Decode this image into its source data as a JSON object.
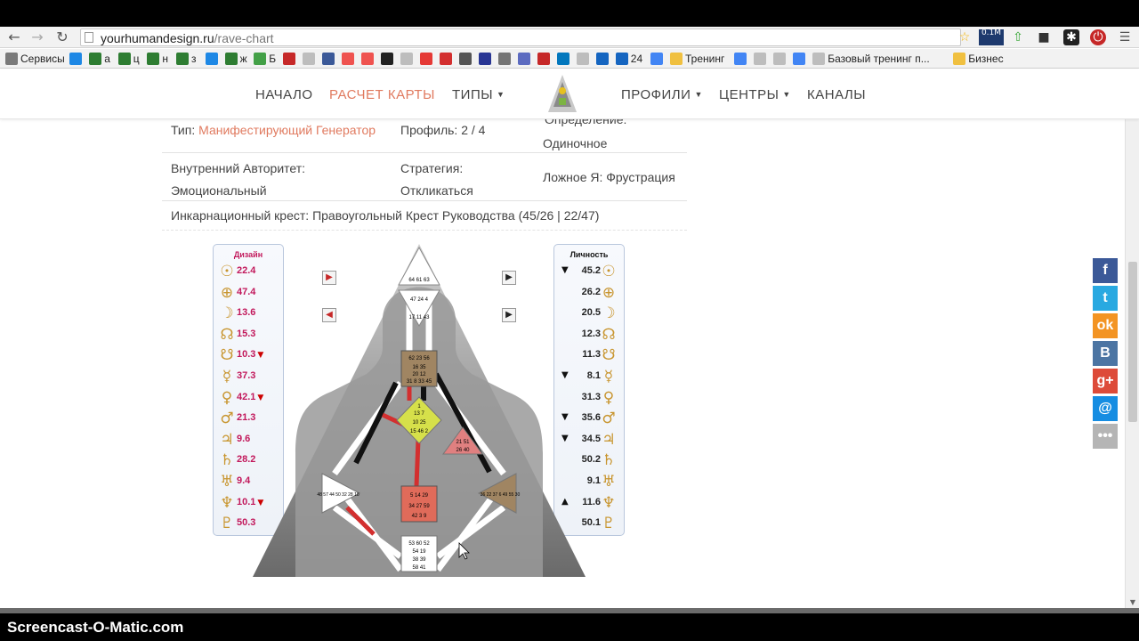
{
  "browser": {
    "url_host": "yourhumandesign.ru",
    "url_path": "/rave-chart",
    "extensions": [
      "star-icon",
      "rss-badge-icon",
      "arrow-up-icon",
      "puzzle-icon",
      "asterisk-icon",
      "stop-icon",
      "menu-icon"
    ],
    "rss_badge": "0.1M"
  },
  "bookmarks": [
    {
      "label": "Сервисы",
      "color": "#7a7a7a"
    },
    {
      "label": "",
      "color": "#1e88e5"
    },
    {
      "label": "а",
      "color": "#2e7d32"
    },
    {
      "label": "ц",
      "color": "#2e7d32"
    },
    {
      "label": "н",
      "color": "#2e7d32"
    },
    {
      "label": "з",
      "color": "#2e7d32"
    },
    {
      "label": "",
      "color": "#1e88e5"
    },
    {
      "label": "ж",
      "color": "#2e7d32"
    },
    {
      "label": "Б",
      "color": "#43a047"
    },
    {
      "label": "",
      "color": "#c62828"
    },
    {
      "label": "",
      "color": "#bdbdbd"
    },
    {
      "label": "",
      "color": "#3b5998"
    },
    {
      "label": "",
      "color": "#ef5350"
    },
    {
      "label": "",
      "color": "#ef5350"
    },
    {
      "label": "",
      "color": "#222222"
    },
    {
      "label": "",
      "color": "#bdbdbd"
    },
    {
      "label": "",
      "color": "#e53935"
    },
    {
      "label": "",
      "color": "#d32f2f"
    },
    {
      "label": "",
      "color": "#555555"
    },
    {
      "label": "",
      "color": "#283593"
    },
    {
      "label": "",
      "color": "#757575"
    },
    {
      "label": "",
      "color": "#5c6bc0"
    },
    {
      "label": "",
      "color": "#c62828"
    },
    {
      "label": "",
      "color": "#0277bd"
    },
    {
      "label": "",
      "color": "#bdbdbd"
    },
    {
      "label": "",
      "color": "#1565c0"
    },
    {
      "label": "24",
      "color": "#1565c0"
    },
    {
      "label": "",
      "color": "#4285f4"
    },
    {
      "label": "Тренинг",
      "color": "#f0c040"
    },
    {
      "label": "",
      "color": "#4285f4"
    },
    {
      "label": "",
      "color": "#bdbdbd"
    },
    {
      "label": "",
      "color": "#bdbdbd"
    },
    {
      "label": "",
      "color": "#4285f4"
    },
    {
      "label": "Базовый тренинг п...",
      "color": "#bdbdbd"
    },
    {
      "label": "Бизнес",
      "color": "#f0c040"
    }
  ],
  "nav": {
    "items": [
      {
        "label": "НАЧАЛО",
        "has_caret": false,
        "active": false
      },
      {
        "label": "РАСЧЕТ КАРТЫ",
        "has_caret": false,
        "active": true
      },
      {
        "label": "ТИПЫ",
        "has_caret": true,
        "active": false
      },
      {
        "label": "ПРОФИЛИ",
        "has_caret": true,
        "active": false
      },
      {
        "label": "ЦЕНТРЫ",
        "has_caret": true,
        "active": false
      },
      {
        "label": "КАНАЛЫ",
        "has_caret": false,
        "active": false
      }
    ],
    "active_color": "#e07a5f"
  },
  "info": {
    "type_label": "Тип:",
    "type_value": "Манифестирующий Генератор",
    "profile_label": "Профиль:",
    "profile_value": "2 / 4",
    "definition_label": "Определение:",
    "definition_value": "Одиночное",
    "authority_label": "Внутренний Авторитет:",
    "authority_value": "Эмоциональный",
    "strategy_label": "Стратегия:",
    "strategy_value": "Откликаться",
    "notself_label": "Ложное Я:",
    "notself_value": "Фрустрация",
    "cross_label": "Инкарнационный крест:",
    "cross_value": "Правоугольный Крест Руководства (45/26 | 22/47)"
  },
  "chart": {
    "design_title": "Дизайн",
    "personality_title": "Личность",
    "design_color": "#c2185b",
    "planet_color": "#c8952f",
    "design": [
      {
        "planet": "sun",
        "glyph": "☉",
        "value": "22.4",
        "arrow": ""
      },
      {
        "planet": "earth",
        "glyph": "⊕",
        "value": "47.4",
        "arrow": ""
      },
      {
        "planet": "moon",
        "glyph": "☽",
        "value": "13.6",
        "arrow": ""
      },
      {
        "planet": "north-node",
        "glyph": "☊",
        "value": "15.3",
        "arrow": ""
      },
      {
        "planet": "south-node",
        "glyph": "☋",
        "value": "10.3",
        "arrow": "▼"
      },
      {
        "planet": "mercury",
        "glyph": "☿",
        "value": "37.3",
        "arrow": ""
      },
      {
        "planet": "venus",
        "glyph": "♀",
        "value": "42.1",
        "arrow": "▼"
      },
      {
        "planet": "mars",
        "glyph": "♂",
        "value": "21.3",
        "arrow": ""
      },
      {
        "planet": "jupiter",
        "glyph": "♃",
        "value": "9.6",
        "arrow": ""
      },
      {
        "planet": "saturn",
        "glyph": "♄",
        "value": "28.2",
        "arrow": ""
      },
      {
        "planet": "uranus",
        "glyph": "♅",
        "value": "9.4",
        "arrow": ""
      },
      {
        "planet": "neptune",
        "glyph": "♆",
        "value": "10.1",
        "arrow": "▼"
      },
      {
        "planet": "pluto",
        "glyph": "♇",
        "value": "50.3",
        "arrow": ""
      }
    ],
    "personality": [
      {
        "planet": "sun",
        "glyph": "☉",
        "value": "45.2",
        "arrow": "▼"
      },
      {
        "planet": "earth",
        "glyph": "⊕",
        "value": "26.2",
        "arrow": ""
      },
      {
        "planet": "moon",
        "glyph": "☽",
        "value": "20.5",
        "arrow": ""
      },
      {
        "planet": "north-node",
        "glyph": "☊",
        "value": "12.3",
        "arrow": ""
      },
      {
        "planet": "south-node",
        "glyph": "☋",
        "value": "11.3",
        "arrow": ""
      },
      {
        "planet": "mercury",
        "glyph": "☿",
        "value": "8.1",
        "arrow": "▼"
      },
      {
        "planet": "venus",
        "glyph": "♀",
        "value": "31.3",
        "arrow": ""
      },
      {
        "planet": "mars",
        "glyph": "♂",
        "value": "35.6",
        "arrow": "▼"
      },
      {
        "planet": "jupiter",
        "glyph": "♃",
        "value": "34.5",
        "arrow": "▼"
      },
      {
        "planet": "saturn",
        "glyph": "♄",
        "value": "50.2",
        "arrow": ""
      },
      {
        "planet": "uranus",
        "glyph": "♅",
        "value": "9.1",
        "arrow": ""
      },
      {
        "planet": "neptune",
        "glyph": "♆",
        "value": "11.6",
        "arrow": "▲"
      },
      {
        "planet": "pluto",
        "glyph": "♇",
        "value": "50.1",
        "arrow": ""
      }
    ],
    "centers": {
      "head": {
        "gates": "64 61 63",
        "defined": false,
        "color": "#ffffff"
      },
      "ajna": {
        "gates": "47 24 4",
        "gates2": "17 11 43",
        "defined": false,
        "color": "#ffffff"
      },
      "throat": {
        "gates": "62 23 56",
        "gates2": "16 35",
        "gates3": "20 12",
        "gates4": "31 8 33 45",
        "defined": true,
        "color": "#a08562"
      },
      "g_center": {
        "gates": "1",
        "gates2": "13 7",
        "gates3": "10 25",
        "gates4": "15 46 2",
        "defined": true,
        "color": "#d6e04a"
      },
      "heart": {
        "gates": "21 51",
        "gates2": "26 40",
        "defined": true,
        "color": "#e08080"
      },
      "spleen": {
        "gates": "48 57 44 50 32 28 18",
        "defined": false,
        "color": "#ffffff"
      },
      "sacral": {
        "gates": "5 14 29",
        "gates2": "34 27 59",
        "gates3": "42 3 9",
        "defined": true,
        "color": "#e06b5a"
      },
      "solar_plexus": {
        "gates": "36 22 37 6 49 55 30",
        "defined": true,
        "color": "#a08562"
      },
      "root": {
        "gates": "53 60 52",
        "gates2": "54 19",
        "gates3": "38 39",
        "gates4": "58 41",
        "defined": false,
        "color": "#ffffff"
      }
    }
  },
  "social": [
    {
      "name": "facebook-button",
      "label": "f",
      "color": "#3b5998"
    },
    {
      "name": "twitter-button",
      "label": "t",
      "color": "#29a9e1"
    },
    {
      "name": "odnoklassniki-button",
      "label": "ok",
      "color": "#f39423"
    },
    {
      "name": "vkontakte-button",
      "label": "В",
      "color": "#4c75a3"
    },
    {
      "name": "googleplus-button",
      "label": "g+",
      "color": "#dd4b39"
    },
    {
      "name": "mailru-button",
      "label": "@",
      "color": "#168de2"
    },
    {
      "name": "more-share-button",
      "label": "•••",
      "color": "#b5b5b5"
    }
  ],
  "watermark": "Screencast-O-Matic.com"
}
